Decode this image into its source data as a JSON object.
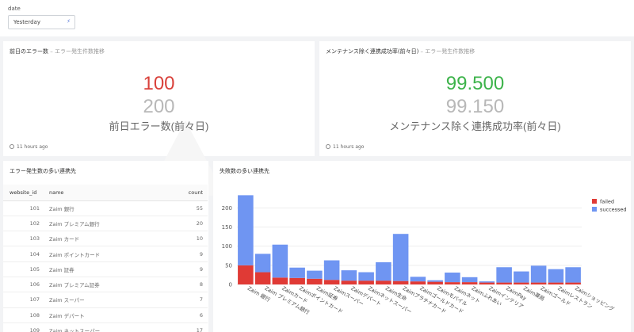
{
  "filter": {
    "label": "date",
    "value": "Yesterday"
  },
  "kpi_left": {
    "title": "前日のエラー数",
    "subtitle": " – エラー発生件数推移",
    "value": "100",
    "previous": "200",
    "caption": "前日エラー数(前々日)",
    "updated": "11 hours ago",
    "color": "#d9413b"
  },
  "kpi_right": {
    "title": "メンテナンス除く連携成功率(前々日)",
    "subtitle": " – エラー発生件数推移",
    "value": "99.500",
    "previous": "99.150",
    "caption": "メンテナンス除く連携成功率(前々日)",
    "updated": "11 hours ago",
    "color": "#3cb34a"
  },
  "table": {
    "title": "エラー発生数の多い連携先",
    "columns": [
      "website_id",
      "name",
      "count"
    ],
    "rows": [
      [
        "101",
        "Zaim 銀行",
        "55"
      ],
      [
        "102",
        "Zaim プレミアム銀行",
        "20"
      ],
      [
        "103",
        "Zaim カード",
        "10"
      ],
      [
        "104",
        "Zaim ポイントカード",
        "9"
      ],
      [
        "105",
        "Zaim 証券",
        "9"
      ],
      [
        "106",
        "Zaim プレミアム証券",
        "8"
      ],
      [
        "107",
        "Zaim スーパー",
        "7"
      ],
      [
        "108",
        "Zaim デパート",
        "6"
      ],
      [
        "109",
        "Zaim ネットスーパー",
        "17"
      ]
    ]
  },
  "bar_card": {
    "title": "失敗数の多い連携先"
  },
  "chart_data": {
    "type": "bar",
    "stacked": true,
    "categories": [
      "Zaim 銀行",
      "Zaim プレミアム銀行",
      "Zaimカード",
      "Zaimポイントカード",
      "Zaim証券",
      "Zaimスーパー",
      "Zaimデパート",
      "Zaimネットスーパー",
      "Zaim生命",
      "Zaimプラチナカード",
      "Zaimゴールドカード",
      "Zaimモバイル",
      "Zaimネット",
      "Zaimふれあい",
      "Zaimインテリア",
      "ZaimPay",
      "Zaim薬局",
      "Zaimゴールド",
      "Zaimレストラン",
      "Zaimショッピング"
    ],
    "series": [
      {
        "name": "failed",
        "color": "#e03a35",
        "values": [
          50,
          32,
          18,
          17,
          15,
          12,
          10,
          10,
          10,
          9,
          8,
          7,
          6,
          6,
          5,
          5,
          5,
          5,
          5,
          5
        ]
      },
      {
        "name": "successed",
        "color": "#6f95f2",
        "values": [
          183,
          48,
          86,
          27,
          21,
          51,
          27,
          22,
          48,
          123,
          12,
          4,
          25,
          13,
          3,
          40,
          29,
          44,
          35,
          40
        ]
      }
    ],
    "ylim": [
      0,
      240
    ],
    "yticks": [
      0,
      50,
      100,
      150,
      200
    ],
    "legend": "right"
  }
}
